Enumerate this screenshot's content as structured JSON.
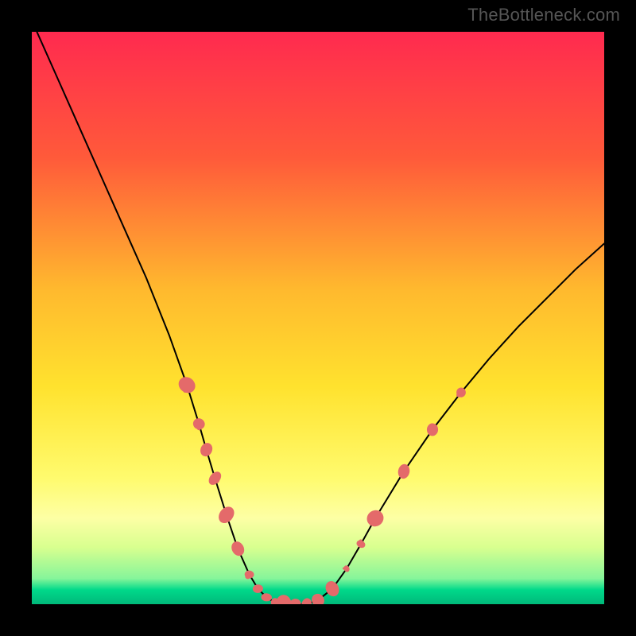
{
  "watermark": "TheBottleneck.com",
  "chart_data": {
    "type": "line",
    "title": "",
    "xlabel": "",
    "ylabel": "",
    "xlim": [
      0,
      100
    ],
    "ylim": [
      0,
      100
    ],
    "background_gradient_stops": [
      {
        "pos": 0.0,
        "color": "#ff2a4f"
      },
      {
        "pos": 0.22,
        "color": "#ff5a3a"
      },
      {
        "pos": 0.45,
        "color": "#ffb92e"
      },
      {
        "pos": 0.62,
        "color": "#ffe22e"
      },
      {
        "pos": 0.78,
        "color": "#fffb6e"
      },
      {
        "pos": 0.85,
        "color": "#fdffa5"
      },
      {
        "pos": 0.9,
        "color": "#d9ff8f"
      },
      {
        "pos": 0.955,
        "color": "#86f59a"
      },
      {
        "pos": 0.975,
        "color": "#00d98a"
      },
      {
        "pos": 1.0,
        "color": "#00b87a"
      }
    ],
    "series": [
      {
        "name": "bottleneck-curve",
        "color": "#000000",
        "stroke_width": 2,
        "x": [
          0,
          4,
          8,
          12,
          16,
          20,
          24,
          27.1,
          29.2,
          30.5,
          32,
          34,
          36,
          38,
          39.5,
          41,
          42.5,
          44,
          46,
          48,
          50,
          52.5,
          55,
          57.5,
          60,
          65,
          70,
          75,
          80,
          85,
          90,
          95,
          100
        ],
        "y": [
          102,
          93,
          84,
          75,
          66,
          57,
          47,
          38.3,
          31.5,
          27,
          22,
          15.6,
          9.7,
          5.2,
          2.7,
          1.2,
          0.3,
          0,
          0,
          0,
          0.7,
          2.7,
          6.2,
          10.5,
          15,
          23.2,
          30.5,
          37,
          43,
          48.5,
          53.5,
          58.5,
          63
        ]
      }
    ],
    "marker_clusters": [
      {
        "name": "left-slope-markers",
        "color": "#e46a6a",
        "radius_range": [
          4,
          9
        ],
        "points": [
          {
            "x": 27.1,
            "y": 38.3
          },
          {
            "x": 29.2,
            "y": 31.5
          },
          {
            "x": 30.5,
            "y": 27.0
          },
          {
            "x": 32.0,
            "y": 22.0
          },
          {
            "x": 34.0,
            "y": 15.6
          },
          {
            "x": 36.0,
            "y": 9.7
          },
          {
            "x": 38.0,
            "y": 5.2
          },
          {
            "x": 39.5,
            "y": 2.7
          }
        ]
      },
      {
        "name": "valley-markers",
        "color": "#e46a6a",
        "radius_range": [
          4,
          9
        ],
        "points": [
          {
            "x": 41.0,
            "y": 1.2
          },
          {
            "x": 42.5,
            "y": 0.3
          },
          {
            "x": 44.0,
            "y": 0.0
          },
          {
            "x": 46.0,
            "y": 0.0
          },
          {
            "x": 48.0,
            "y": 0.0
          },
          {
            "x": 50.0,
            "y": 0.7
          }
        ]
      },
      {
        "name": "right-slope-markers",
        "color": "#e46a6a",
        "radius_range": [
          4,
          9
        ],
        "points": [
          {
            "x": 52.5,
            "y": 2.7
          },
          {
            "x": 55.0,
            "y": 6.2
          },
          {
            "x": 57.5,
            "y": 10.5
          },
          {
            "x": 60.0,
            "y": 15.0
          },
          {
            "x": 65.0,
            "y": 23.2
          },
          {
            "x": 70.0,
            "y": 30.5
          },
          {
            "x": 75.0,
            "y": 37.0
          }
        ]
      }
    ]
  }
}
